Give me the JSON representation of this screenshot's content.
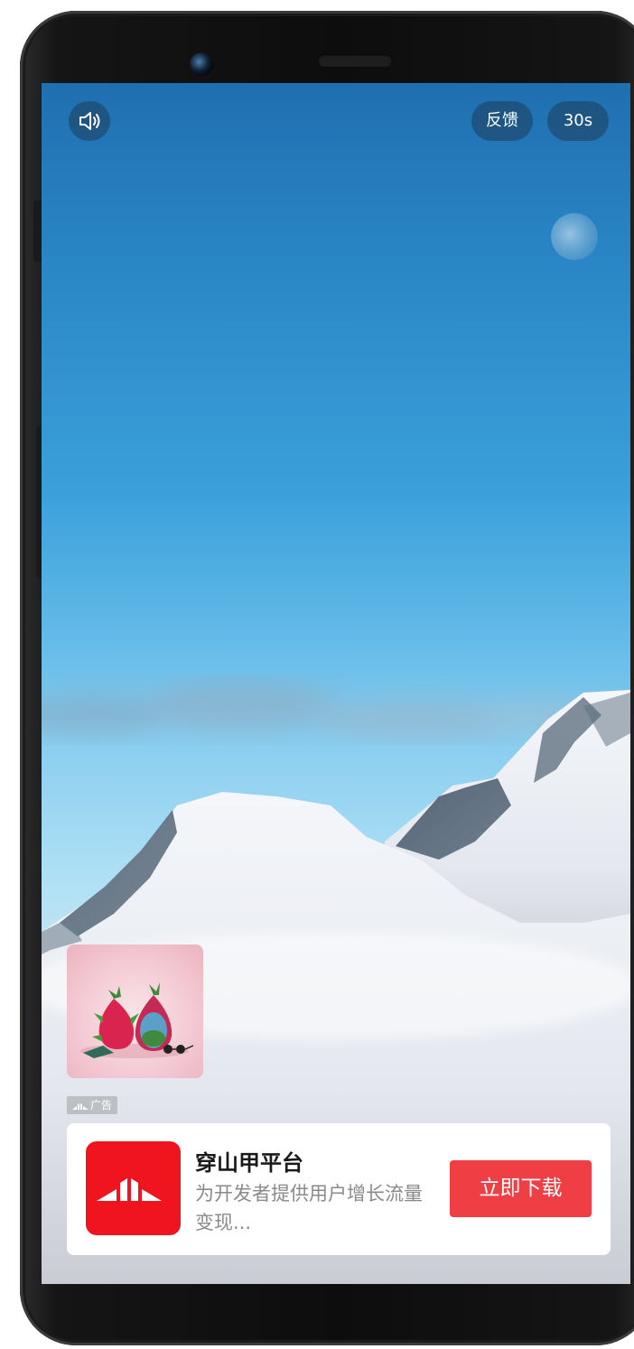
{
  "top_bar": {
    "sound_icon": "speaker-icon",
    "feedback_label": "反馈",
    "timer_label": "30s"
  },
  "ad": {
    "badge_label": "广告",
    "app_title": "穿山甲平台",
    "app_desc": "为开发者提供用户增长流量变现...",
    "download_label": "立即下载",
    "brand_color": "#f0141e",
    "button_color": "#ef3f44"
  }
}
